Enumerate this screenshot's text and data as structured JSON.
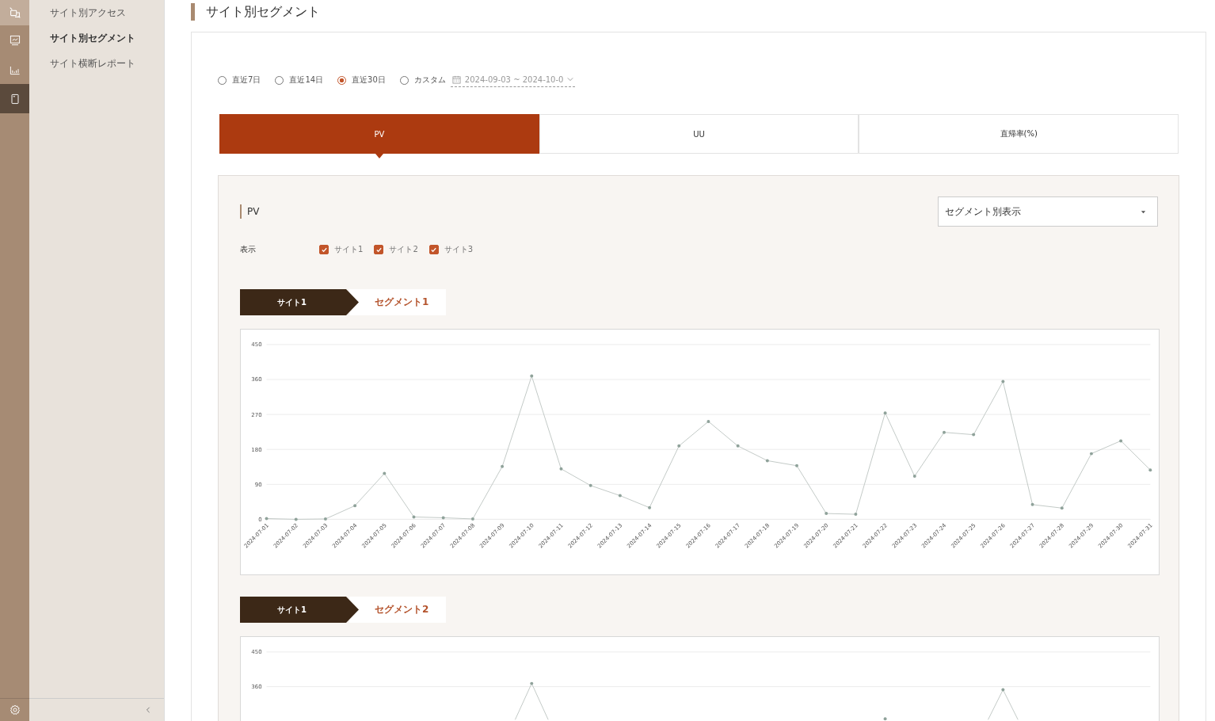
{
  "sidebar": {
    "items": [
      {
        "label": "サイト別アクセス",
        "selected": false
      },
      {
        "label": "サイト別セグメント",
        "selected": true
      },
      {
        "label": "サイト横断レポート",
        "selected": false
      }
    ],
    "rail": [
      {
        "selected": false
      },
      {
        "selected": false
      },
      {
        "selected": true
      }
    ]
  },
  "page_title": "サイト別セグメント",
  "period": {
    "options": [
      {
        "label": "直近7日",
        "selected": false
      },
      {
        "label": "直近14日",
        "selected": false
      },
      {
        "label": "直近30日",
        "selected": true
      },
      {
        "label": "カスタム",
        "selected": false
      }
    ],
    "date_range": "2024-09-03 ~ 2024-10-0"
  },
  "metric_tabs": [
    {
      "label": "PV",
      "selected": true
    },
    {
      "label": "UU",
      "selected": false
    },
    {
      "label": "直帰率(%)",
      "selected": false
    }
  ],
  "panel": {
    "title": "PV",
    "view_select": "セグメント別表示",
    "display_label": "表示",
    "sites": [
      {
        "label": "サイト1",
        "checked": true
      },
      {
        "label": "サイト2",
        "checked": true
      },
      {
        "label": "サイト3",
        "checked": true
      }
    ]
  },
  "segments": [
    {
      "site": "サイト1",
      "segment": "セグメント1",
      "chart_data": {
        "type": "line",
        "categories": [
          "2024-07-01",
          "2024-07-02",
          "2024-07-03",
          "2024-07-04",
          "2024-07-05",
          "2024-07-06",
          "2024-07-07",
          "2024-07-08",
          "2024-07-09",
          "2024-07-10",
          "2024-07-11",
          "2024-07-12",
          "2024-07-13",
          "2024-07-14",
          "2024-07-15",
          "2024-07-16",
          "2024-07-17",
          "2024-07-18",
          "2024-07-19",
          "2024-07-20",
          "2024-07-21",
          "2024-07-22",
          "2024-07-23",
          "2024-07-24",
          "2024-07-25",
          "2024-07-26",
          "2024-07-27",
          "2024-07-28",
          "2024-07-29",
          "2024-07-30",
          "2024-07-31"
        ],
        "ylim": [
          0,
          450
        ],
        "yticks": [
          0,
          90,
          180,
          270,
          360,
          450
        ],
        "grid": true,
        "series": [
          {
            "color": "#c3cac7",
            "values": [
              2,
              0,
              1,
              35,
              118,
              6,
              4,
              1,
              136,
              369,
              130,
              87,
              61,
              30,
              189,
              252,
              189,
              151,
              138,
              15,
              13,
              274,
              111,
              224,
              218,
              355,
              38,
              29,
              169,
              202,
              127
            ]
          }
        ]
      }
    },
    {
      "site": "サイト1",
      "segment": "セグメント2",
      "y_labels": [
        "450",
        "360"
      ]
    }
  ]
}
